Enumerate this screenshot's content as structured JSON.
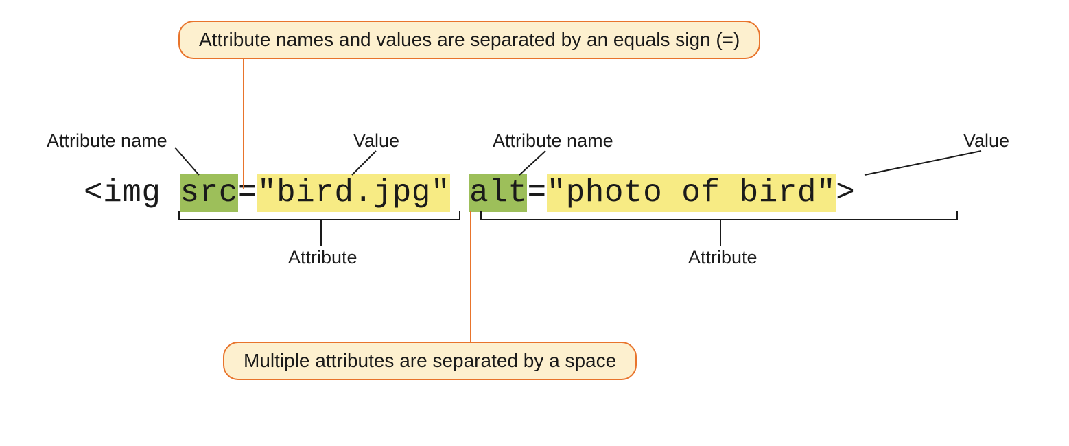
{
  "callouts": {
    "top": "Attribute names and values are separated by an equals sign (=)",
    "bottom": "Multiple attributes are separated by a space"
  },
  "labels": {
    "attr_name1": "Attribute name",
    "value1": "Value",
    "attr_name2": "Attribute name",
    "value2": "Value",
    "attribute1": "Attribute",
    "attribute2": "Attribute"
  },
  "code": {
    "open": "<img ",
    "src_name": "src",
    "eq1": "=",
    "src_value": "\"bird.jpg\"",
    "space": " ",
    "alt_name": "alt",
    "eq2": "=",
    "alt_value": "\"photo of bird\"",
    "close": ">"
  }
}
